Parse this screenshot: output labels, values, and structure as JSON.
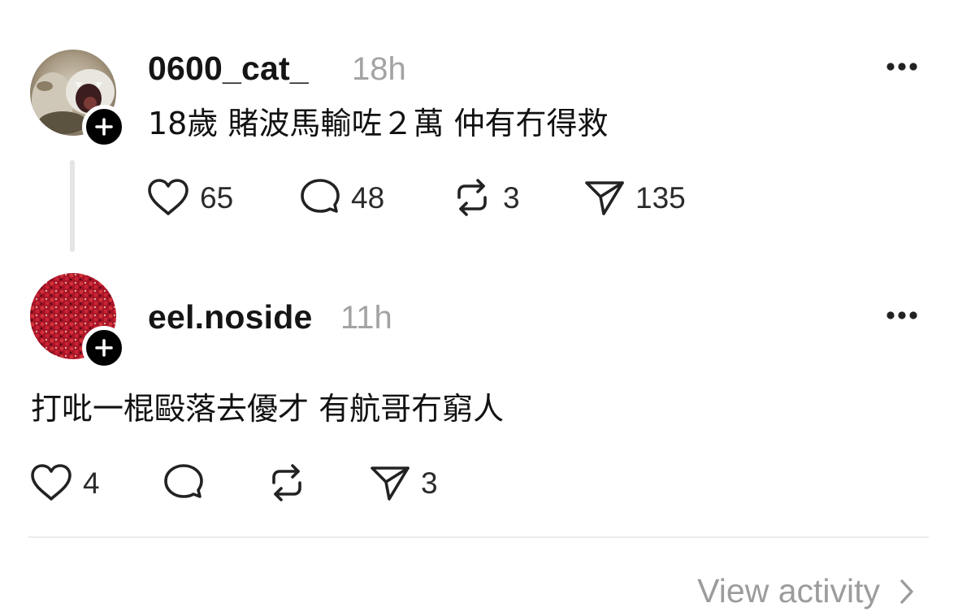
{
  "posts": [
    {
      "username": "0600_cat_",
      "time": "18h",
      "text": "18歲 賭波馬輸咗２萬 仲有冇得救",
      "likes": "65",
      "replies": "48",
      "reposts": "3",
      "shares": "135"
    },
    {
      "username": "eel.noside",
      "time": "11h",
      "text": "打吡一棍毆落去優才 有航哥冇窮人",
      "likes": "4",
      "replies": "",
      "reposts": "",
      "shares": "3"
    }
  ],
  "footer": {
    "view_activity": "View activity"
  },
  "icons": {
    "like": "heart-icon",
    "reply": "comment-bubble-icon",
    "repost": "repost-arrows-icon",
    "share": "send-paper-plane-icon",
    "more": "more-dots-icon",
    "follow": "plus-icon",
    "chevron": "chevron-right-icon"
  },
  "colors": {
    "text": "#111111",
    "muted": "#a3a3a3",
    "follow_badge": "#000000",
    "thread_line": "#e5e5e5"
  }
}
